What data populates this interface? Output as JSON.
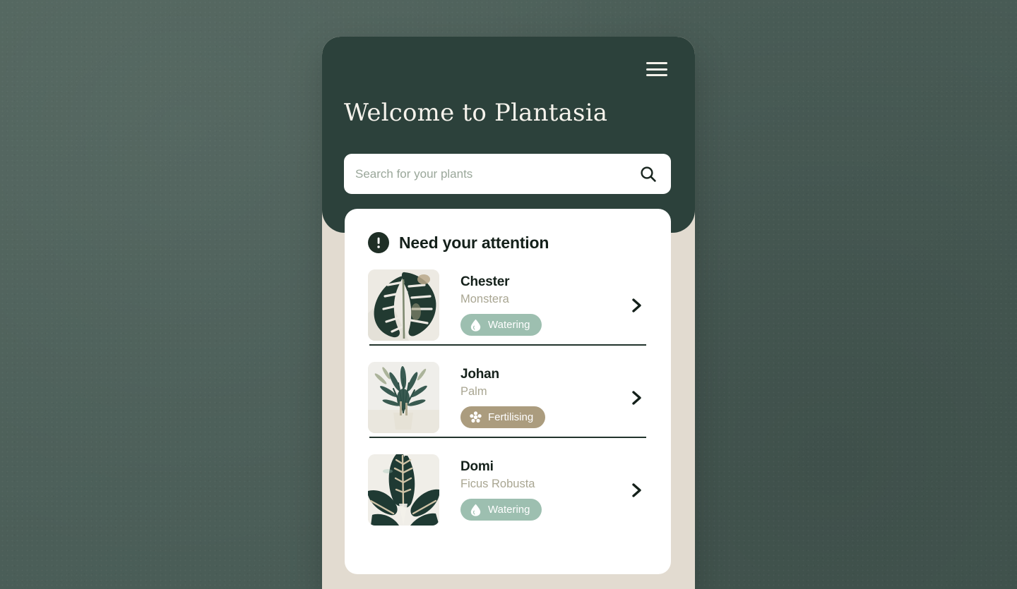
{
  "app": {
    "title": "Welcome to Plantasia",
    "menu_icon": "hamburger-menu-icon",
    "brand_dark": "#2c413b",
    "brand_beige": "#e2dbd0",
    "backdrop": "#4a5d57"
  },
  "search": {
    "placeholder": "Search for your plants",
    "value": "",
    "icon": "search-icon"
  },
  "attention": {
    "icon": "exclamation-icon",
    "heading": "Need your attention",
    "plants": [
      {
        "name": "Chester",
        "species": "Monstera",
        "thumb": "monstera-photo",
        "badge": {
          "label": "Watering",
          "icon": "water-drop-icon",
          "color": "#9dbfb0"
        },
        "chevron": "chevron-right-icon"
      },
      {
        "name": "Johan",
        "species": "Palm",
        "thumb": "palm-photo",
        "badge": {
          "label": "Fertilising",
          "icon": "flower-icon",
          "color": "#ab9c7e"
        },
        "chevron": "chevron-right-icon"
      },
      {
        "name": "Domi",
        "species": "Ficus Robusta",
        "thumb": "ficus-photo",
        "badge": {
          "label": "Watering",
          "icon": "water-drop-icon",
          "color": "#9dbfb0"
        },
        "chevron": "chevron-right-icon"
      }
    ]
  }
}
